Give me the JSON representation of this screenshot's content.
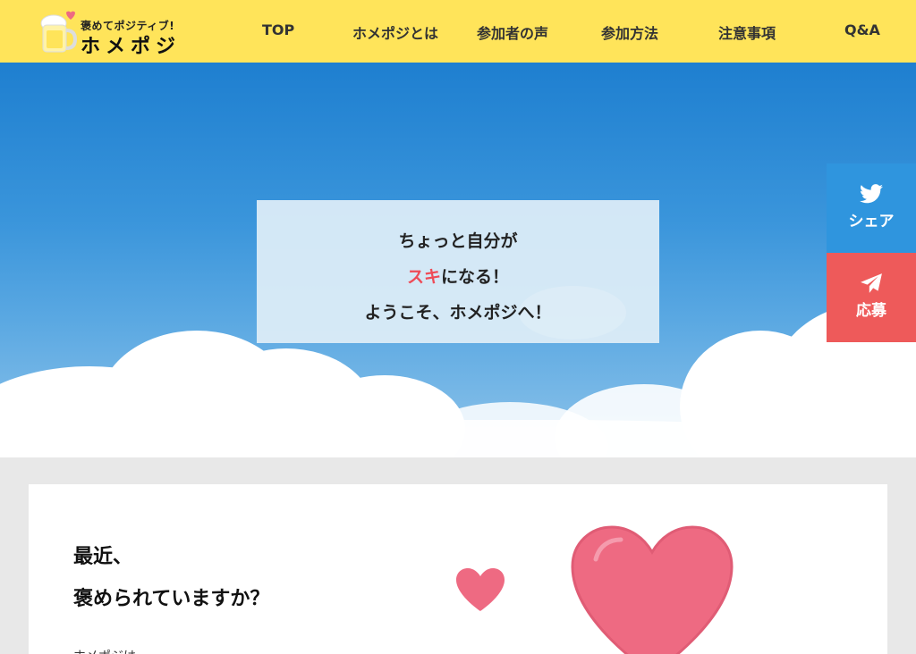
{
  "header": {
    "logo_tagline": "褒めてポジティブ!",
    "logo_name": "ホメポジ",
    "nav": [
      {
        "label": "TOP"
      },
      {
        "label": "ホメポジとは"
      },
      {
        "label": "参加者の声"
      },
      {
        "label": "参加方法"
      },
      {
        "label": "注意事項"
      },
      {
        "label": "Q&A"
      }
    ]
  },
  "hero": {
    "line1": "ちょっと自分が",
    "line2_accent": "スキ",
    "line2_rest": "になる！",
    "line3": "ようこそ、ホメポジへ！"
  },
  "side": {
    "share_label": "シェア",
    "apply_label": "応募",
    "share_icon": "twitter-bird-icon",
    "apply_icon": "paper-plane-icon"
  },
  "content": {
    "heading_line1": "最近、",
    "heading_line2": "褒められていますか？",
    "intro": "ホメポジは"
  },
  "colors": {
    "header_bg": "#ffe45a",
    "accent_red": "#ee4b57",
    "share_blue": "#2f95de",
    "apply_red": "#ee5a5a",
    "heart_pink": "#ee6a82"
  }
}
